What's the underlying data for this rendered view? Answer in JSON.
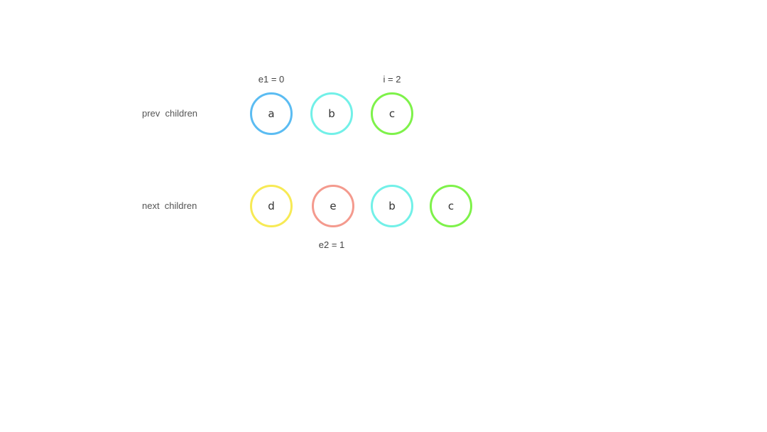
{
  "rows": {
    "prev": {
      "label": "prev  children",
      "nodes": [
        {
          "letter": "a",
          "color": "#5bbcf2"
        },
        {
          "letter": "b",
          "color": "#72f0e8"
        },
        {
          "letter": "c",
          "color": "#7ef24a"
        }
      ]
    },
    "next": {
      "label": "next  children",
      "nodes": [
        {
          "letter": "d",
          "color": "#f7ea55"
        },
        {
          "letter": "e",
          "color": "#f49a8e"
        },
        {
          "letter": "b",
          "color": "#72f0e8"
        },
        {
          "letter": "c",
          "color": "#7ef24a"
        }
      ]
    }
  },
  "pointers": {
    "e1": "e1 = 0",
    "i": "i = 2",
    "e2": "e2 = 1"
  }
}
